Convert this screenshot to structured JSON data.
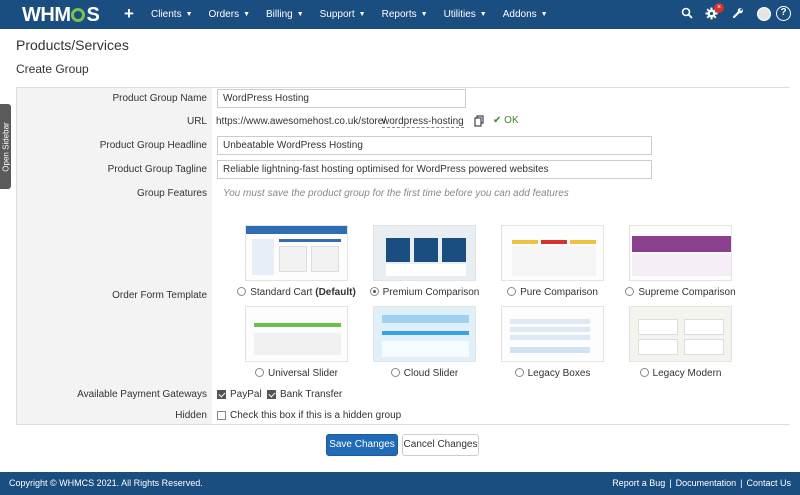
{
  "app": {
    "logo": "WHMCS",
    "logo_pre": "WHM",
    "logo_post": "S"
  },
  "nav": {
    "add_label": "+",
    "items": [
      "Clients",
      "Orders",
      "Billing",
      "Support",
      "Reports",
      "Utilities",
      "Addons"
    ],
    "icons": [
      "search-icon",
      "gear-icon",
      "wrench-icon",
      "avatar",
      "help-icon"
    ],
    "notification_badge": "×",
    "help_label": "?"
  },
  "sidebar": {
    "toggle_label": "Open Sidebar"
  },
  "page": {
    "title": "Products/Services",
    "section": "Create Group"
  },
  "form": {
    "group_name": {
      "label": "Product Group Name",
      "value": "WordPress Hosting"
    },
    "url": {
      "label": "URL",
      "prefix": "https://www.awesomehost.co.uk/store/",
      "slug": "wordpress-hosting",
      "status": "OK"
    },
    "headline": {
      "label": "Product Group Headline",
      "value": "Unbeatable WordPress Hosting"
    },
    "tagline": {
      "label": "Product Group Tagline",
      "value": "Reliable lightning-fast hosting optimised for WordPress powered websites"
    },
    "features": {
      "label": "Group Features",
      "hint": "You must save the product group for the first time before you can add features"
    },
    "order_form": {
      "label": "Order Form Template",
      "selected": "Premium Comparison",
      "templates": [
        {
          "name": "Standard Cart",
          "suffix": "(Default)"
        },
        {
          "name": "Premium Comparison",
          "suffix": ""
        },
        {
          "name": "Pure Comparison",
          "suffix": ""
        },
        {
          "name": "Supreme Comparison",
          "suffix": ""
        },
        {
          "name": "Universal Slider",
          "suffix": ""
        },
        {
          "name": "Cloud Slider",
          "suffix": ""
        },
        {
          "name": "Legacy Boxes",
          "suffix": ""
        },
        {
          "name": "Legacy Modern",
          "suffix": ""
        }
      ]
    },
    "gateways": {
      "label": "Available Payment Gateways",
      "options": [
        {
          "name": "PayPal",
          "checked": true
        },
        {
          "name": "Bank Transfer",
          "checked": true
        }
      ]
    },
    "hidden": {
      "label": "Hidden",
      "checkbox_label": "Check this box if this is a hidden group",
      "checked": false
    }
  },
  "actions": {
    "save": "Save Changes",
    "cancel": "Cancel Changes"
  },
  "footer": {
    "copyright": "Copyright © WHMCS 2021. All Rights Reserved.",
    "links": [
      "Report a Bug",
      "Documentation",
      "Contact Us"
    ]
  },
  "colors": {
    "nav_bg": "#1a4d80",
    "primary": "#1f6bb5",
    "ok": "#3b8a28",
    "badge": "#d9312b"
  }
}
